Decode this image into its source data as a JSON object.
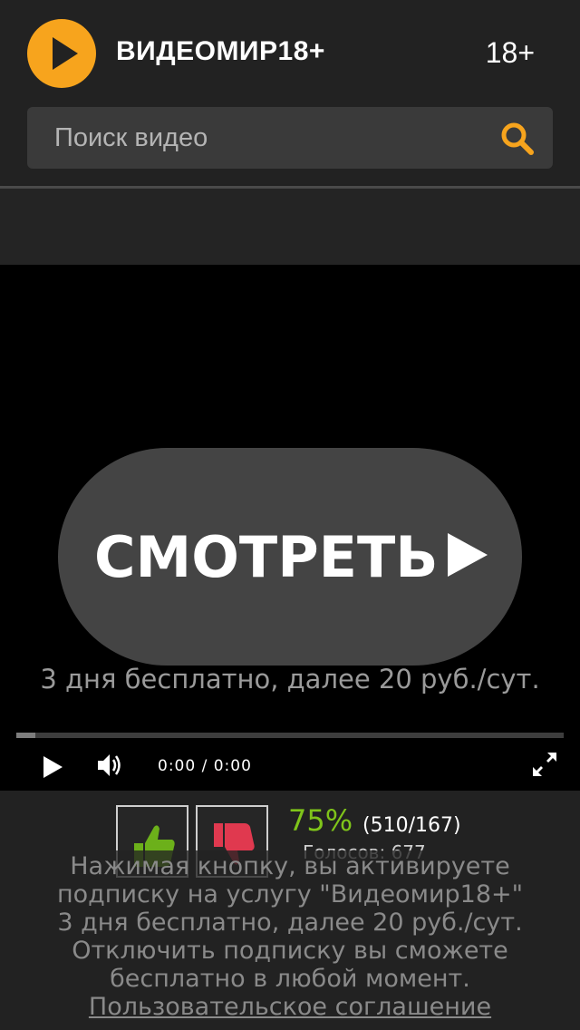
{
  "header": {
    "brand": "ВИДЕОМИР18+",
    "age_badge": "18+",
    "logo_icon": "play-circle-icon",
    "accent_color": "#f7a41d"
  },
  "search": {
    "placeholder": "Поиск видео",
    "icon": "search-icon"
  },
  "player": {
    "watch_label": "СМОТРЕТЬ",
    "watch_icon": "play-icon",
    "price_note": "3 дня бесплатно, далее 20 руб./сут.",
    "progress": 0.035,
    "time": "0:00 / 0:00",
    "controls": [
      "play-icon",
      "volume-icon",
      "fullscreen-icon"
    ]
  },
  "rating": {
    "percent": "75%",
    "counts": "(510/167)",
    "votes": "Голосов: 677",
    "up_icon": "thumbs-up-icon",
    "down_icon": "thumbs-down-icon",
    "positive_color": "#7fc41a"
  },
  "terms": {
    "line1": "Нажимая кнопку, вы активируете",
    "line2": "подписку на услугу \"Видеомир18+\"",
    "line3": "3 дня бесплатно, далее 20 руб./сут.",
    "line4": "Отключить подписку вы сможете",
    "line5": "бесплатно в любой момент.",
    "link": "Пользовательское соглашение"
  }
}
